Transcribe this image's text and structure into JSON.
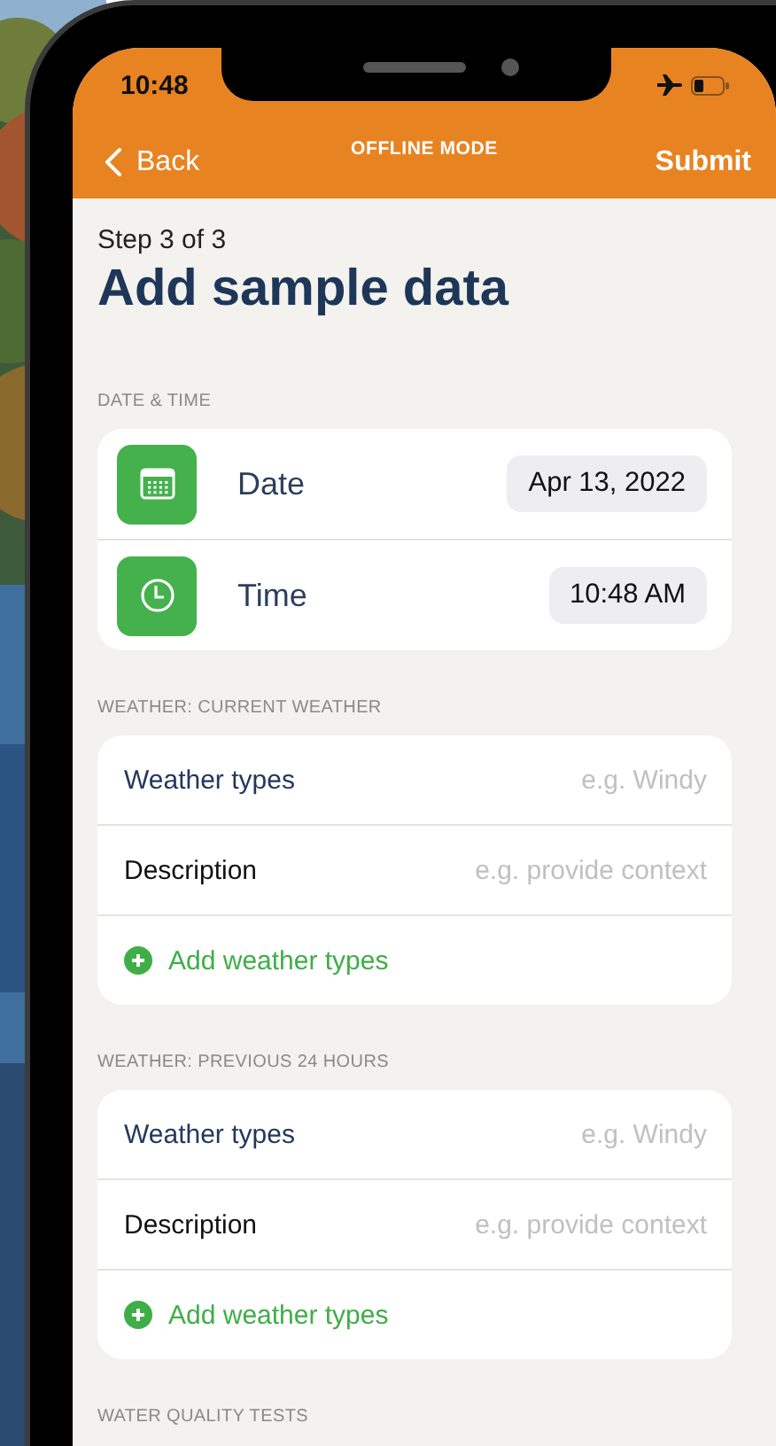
{
  "status_bar": {
    "time": "10:48"
  },
  "nav": {
    "back": "Back",
    "title": "OFFLINE MODE",
    "action": "Submit"
  },
  "step": "Step 3 of 3",
  "heading": "Add sample data",
  "sections": [
    {
      "title": "DATE & TIME",
      "kind": "datetime",
      "rows": [
        {
          "label": "Date",
          "value": "Apr 13, 2022"
        },
        {
          "label": "Time",
          "value": "10:48 AM"
        }
      ]
    },
    {
      "title": "WEATHER: CURRENT WEATHER",
      "kind": "form",
      "fields": [
        {
          "kind": "picker",
          "label": "Weather types",
          "placeholder": "e.g. Windy"
        },
        {
          "kind": "text",
          "label": "Description",
          "placeholder": "e.g. provide context"
        }
      ],
      "add": "Add weather types"
    },
    {
      "title": "WEATHER: PREVIOUS 24 HOURS",
      "kind": "form",
      "fields": [
        {
          "kind": "picker",
          "label": "Weather types",
          "placeholder": "e.g. Windy"
        },
        {
          "kind": "text",
          "label": "Description",
          "placeholder": "e.g. provide context"
        }
      ],
      "add": "Add weather types"
    },
    {
      "title": "WATER QUALITY TESTS",
      "kind": "header"
    }
  ]
}
